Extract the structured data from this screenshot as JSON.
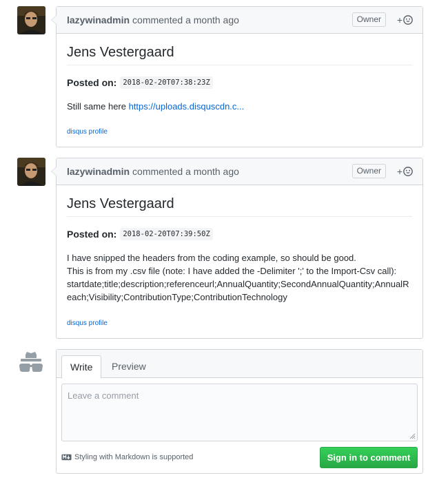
{
  "comments": [
    {
      "author": "lazywinadmin",
      "action": "commented a month ago",
      "badge": "Owner",
      "reaction": "+",
      "title": "Jens Vestergaard",
      "posted_label": "Posted on:",
      "posted_value": "2018-02-20T07:38:23Z",
      "body_text": "Still same here ",
      "body_link": "https://uploads.disquscdn.c...",
      "profile_link": "disqus profile"
    },
    {
      "author": "lazywinadmin",
      "action": "commented a month ago",
      "badge": "Owner",
      "reaction": "+",
      "title": "Jens Vestergaard",
      "posted_label": "Posted on:",
      "posted_value": "2018-02-20T07:39:50Z",
      "body_lines": [
        "I have snipped the headers from the coding example, so should be good.",
        "This is from my .csv file (note: I have added the -Delimiter ';' to the Import-Csv call):",
        "startdate;title;description;referenceurl;AnnualQuantity;SecondAnnualQuantity;AnnualR",
        "each;Visibility;ContributionType;ContributionTechnology"
      ],
      "profile_link": "disqus profile"
    }
  ],
  "editor": {
    "tabs": [
      "Write",
      "Preview"
    ],
    "placeholder": "Leave a comment",
    "markdown_note": "Styling with Markdown is supported",
    "signin_label": "Sign in to comment"
  },
  "colors": {
    "link": "#0366d6",
    "button": "#2ea44f",
    "border": "#d1d5da"
  }
}
